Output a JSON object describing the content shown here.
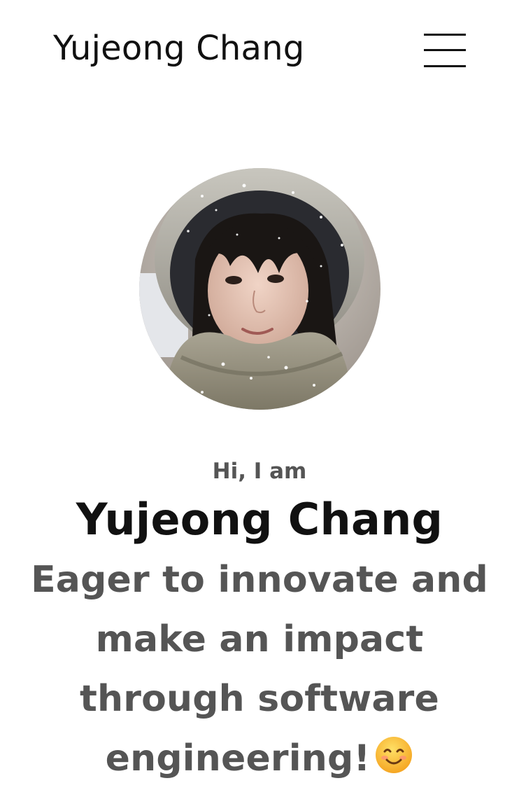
{
  "header": {
    "site_title": "Yujeong Chang",
    "menu_icon": "hamburger-menu-icon"
  },
  "hero": {
    "avatar_alt": "Yujeong Chang",
    "greeting": "Hi, I am",
    "name": "Yujeong Chang",
    "tagline": "Eager to innovate and make an impact through software engineering!",
    "emoji_icon": "smiling-face-emoji-icon"
  },
  "colors": {
    "text_primary": "#111111",
    "text_secondary": "#555555",
    "background": "#ffffff"
  }
}
